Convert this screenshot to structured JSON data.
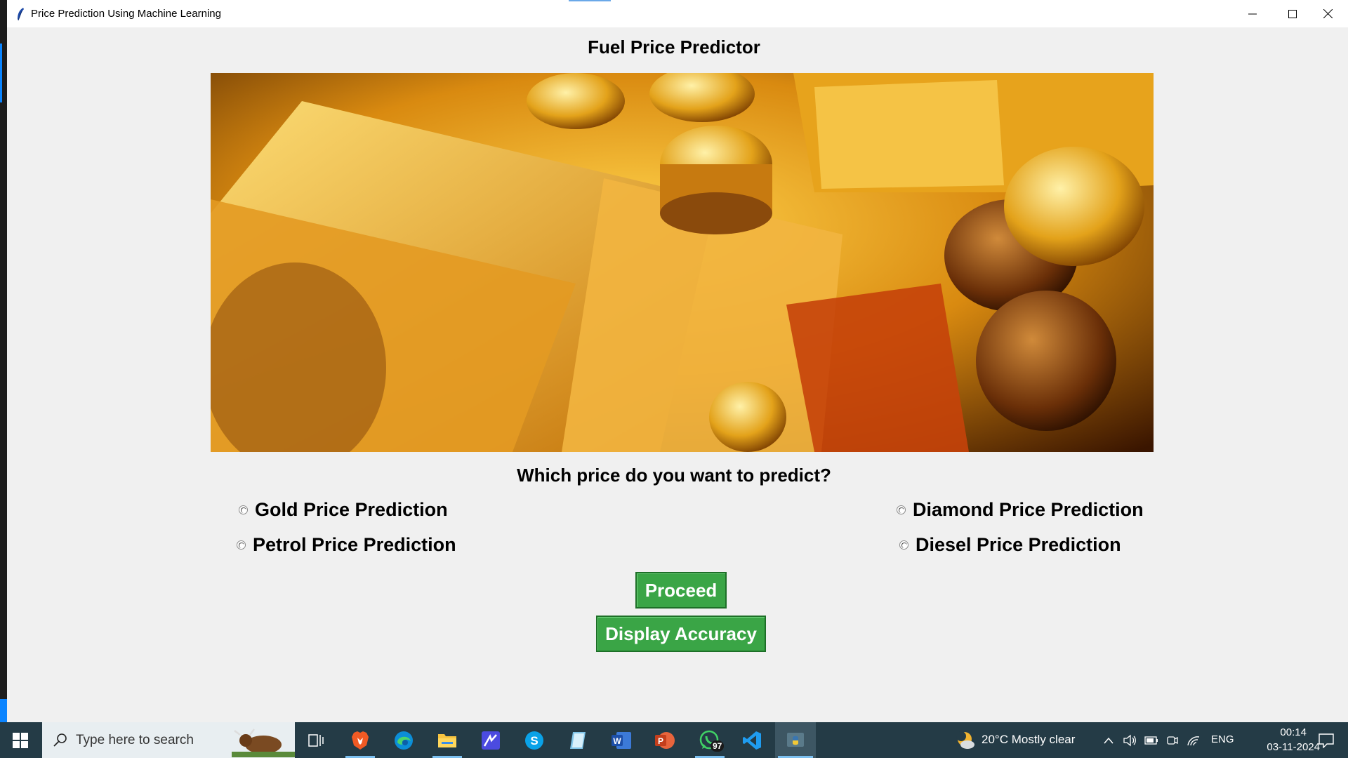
{
  "window": {
    "title": "Price Prediction Using Machine Learning",
    "icon": "feather-icon",
    "controls": [
      "minimize-icon",
      "maximize-icon",
      "close-icon"
    ]
  },
  "app": {
    "heading": "Fuel Price Predictor",
    "banner": {
      "description_icon": "gold-money-banner"
    },
    "question": "Which price do you want to predict?",
    "options": [
      {
        "label": "Gold Price Prediction",
        "selected": false
      },
      {
        "label": "Diamond Price Prediction",
        "selected": false
      },
      {
        "label": "Petrol Price Prediction",
        "selected": false
      },
      {
        "label": "Diesel Price Prediction",
        "selected": false
      }
    ],
    "buttons": {
      "proceed": "Proceed",
      "accuracy": "Display Accuracy"
    },
    "colors": {
      "button_green": "#3aa546",
      "background": "#f0f0f0"
    }
  },
  "taskbar": {
    "search_placeholder": "Type here to search",
    "pinned": [
      "windows-start-icon",
      "search-icon",
      "task-view-icon",
      "brave-icon",
      "edge-icon",
      "file-explorer-icon",
      "app-icon",
      "skype-icon",
      "notepad-icon",
      "word-icon",
      "powerpoint-icon",
      "whatsapp-icon",
      "vscode-icon",
      "python-icon"
    ],
    "whatsapp_badge": "97",
    "weather": "20°C  Mostly clear",
    "language": "ENG",
    "time": "00:14",
    "date": "03-11-2024"
  }
}
